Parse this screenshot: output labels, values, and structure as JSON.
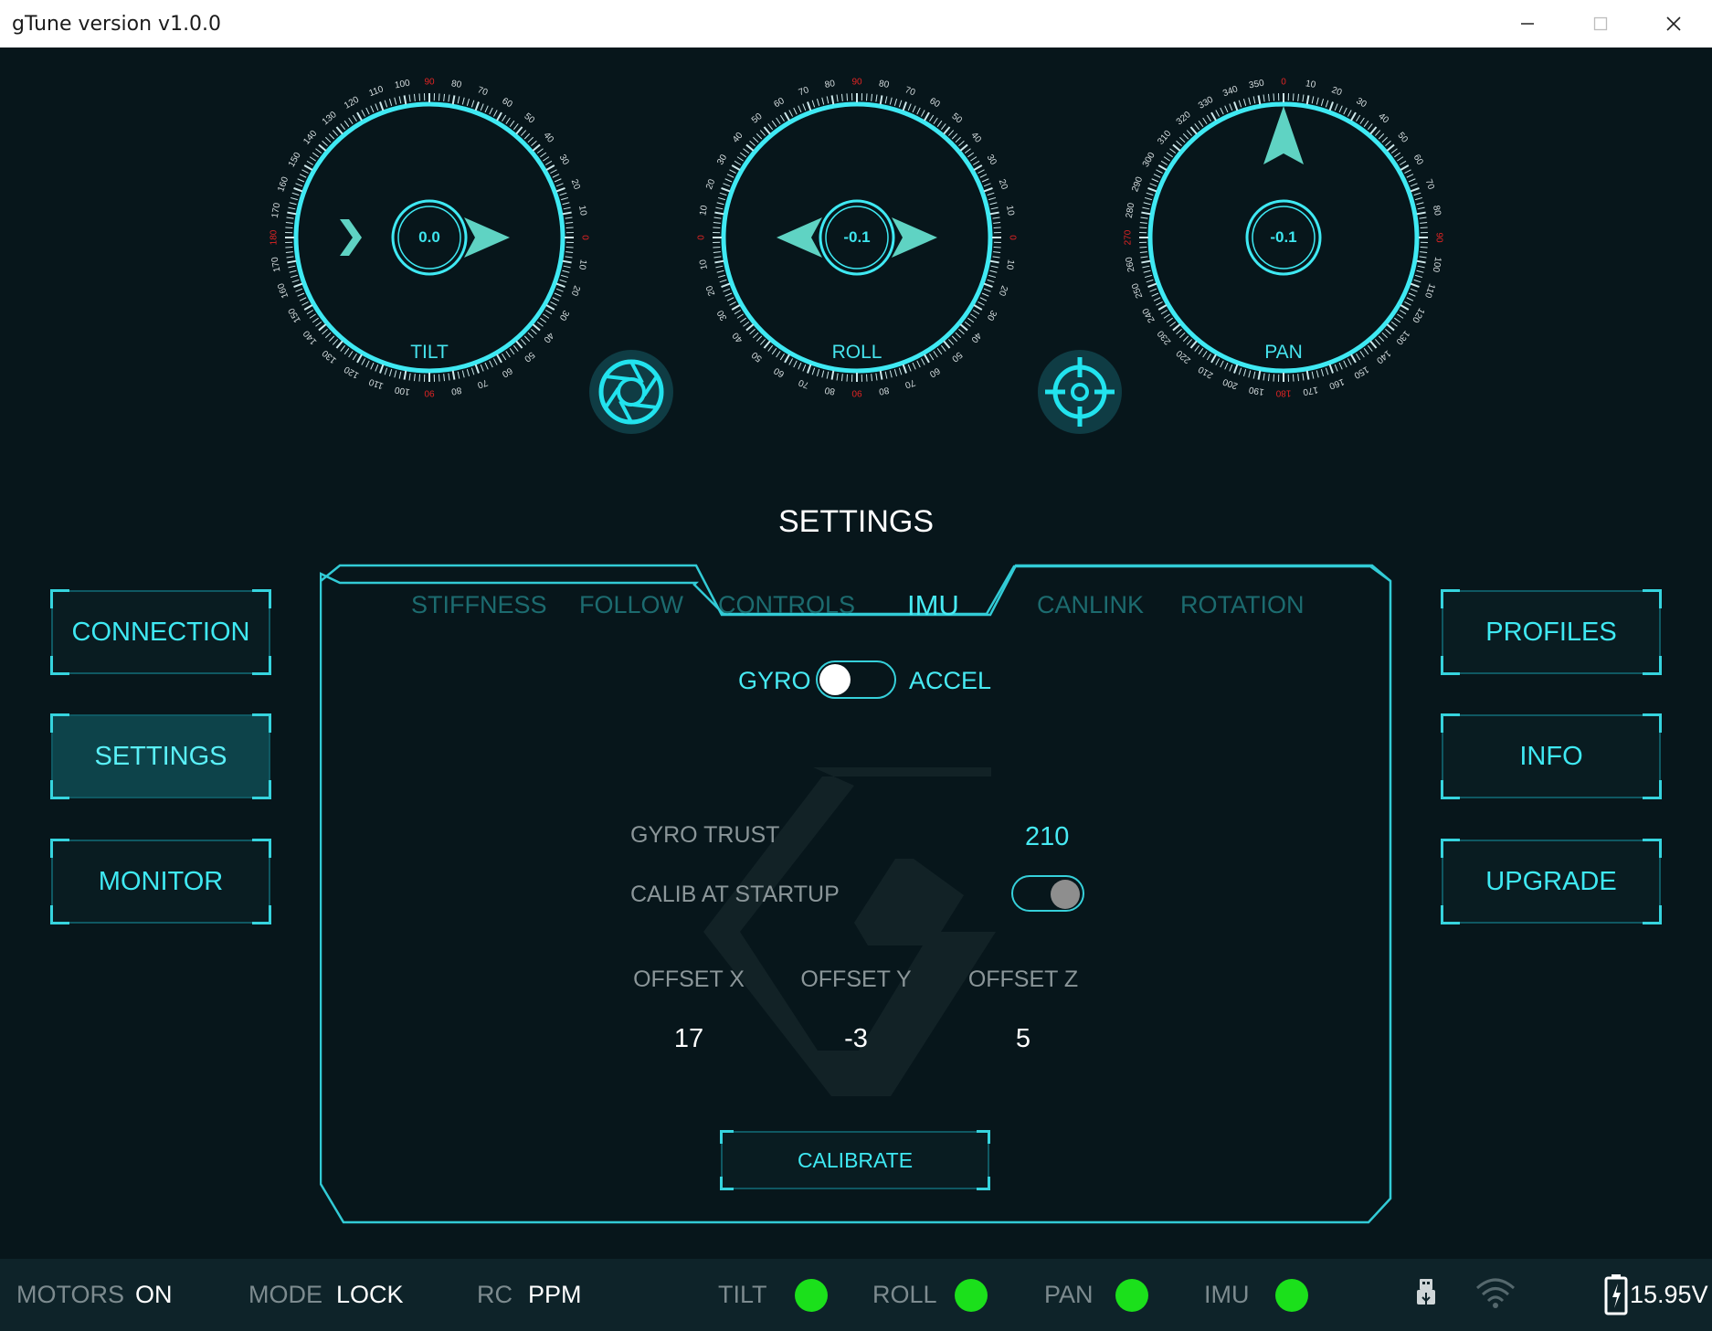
{
  "window": {
    "title": "gTune version v1.0.0"
  },
  "dials": [
    {
      "id": "tilt",
      "label": "TILT",
      "value": "0.0"
    },
    {
      "id": "roll",
      "label": "ROLL",
      "value": "-0.1"
    },
    {
      "id": "pan",
      "label": "PAN",
      "value": "-0.1"
    }
  ],
  "nav": {
    "left": [
      {
        "label": "CONNECTION",
        "active": false
      },
      {
        "label": "SETTINGS",
        "active": true
      },
      {
        "label": "MONITOR",
        "active": false
      }
    ],
    "right": [
      {
        "label": "PROFILES"
      },
      {
        "label": "INFO"
      },
      {
        "label": "UPGRADE"
      }
    ]
  },
  "settings": {
    "title": "SETTINGS",
    "tabs": [
      "STIFFNESS",
      "FOLLOW",
      "CONTROLS",
      "IMU",
      "CANLINK",
      "ROTATION"
    ],
    "active_tab": "IMU",
    "mode_toggle": {
      "left_label": "GYRO",
      "right_label": "ACCEL",
      "selected": "GYRO"
    },
    "gyro_trust": {
      "label": "GYRO TRUST",
      "value": "210"
    },
    "calib_at_startup": {
      "label": "CALIB AT STARTUP",
      "enabled": true
    },
    "offsets": [
      {
        "label": "OFFSET X",
        "value": "17"
      },
      {
        "label": "OFFSET Y",
        "value": "-3"
      },
      {
        "label": "OFFSET Z",
        "value": "5"
      }
    ],
    "calibrate_label": "CALIBRATE"
  },
  "status": {
    "motors": {
      "label": "MOTORS",
      "value": "ON"
    },
    "mode": {
      "label": "MODE",
      "value": "LOCK"
    },
    "rc": {
      "label": "RC",
      "value": "PPM"
    },
    "indicators": [
      {
        "label": "TILT",
        "color": "#1be01b"
      },
      {
        "label": "ROLL",
        "color": "#1be01b"
      },
      {
        "label": "PAN",
        "color": "#1be01b"
      },
      {
        "label": "IMU",
        "color": "#1be01b"
      }
    ],
    "voltage": "15.95V",
    "icons": [
      "usb-icon",
      "wifi-icon",
      "battery-icon"
    ]
  },
  "colors": {
    "accent": "#3fe9f3",
    "background": "#07161b",
    "indicator_ok": "#1be01b",
    "tick_highlight": "#e02424"
  }
}
